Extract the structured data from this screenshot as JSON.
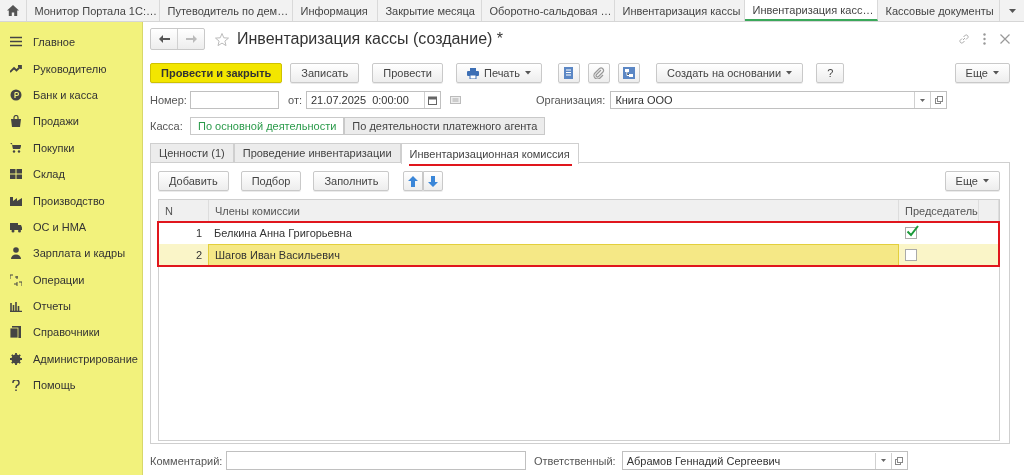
{
  "top_tabs": [
    {
      "label": "Монитор Портала 1С:…",
      "selected": false
    },
    {
      "label": "Путеводитель по дем…",
      "selected": false
    },
    {
      "label": "Информация",
      "selected": false
    },
    {
      "label": "Закрытие месяца",
      "selected": false
    },
    {
      "label": "Оборотно-сальдовая …",
      "selected": false
    },
    {
      "label": "Инвентаризация кассы",
      "selected": false
    },
    {
      "label": "Инвентаризация касс…",
      "selected": true
    },
    {
      "label": "Кассовые документы",
      "selected": false
    }
  ],
  "sidebar": {
    "items": [
      {
        "label": "Главное"
      },
      {
        "label": "Руководителю"
      },
      {
        "label": "Банк и касса"
      },
      {
        "label": "Продажи"
      },
      {
        "label": "Покупки"
      },
      {
        "label": "Склад"
      },
      {
        "label": "Производство"
      },
      {
        "label": "ОС и НМА"
      },
      {
        "label": "Зарплата и кадры"
      },
      {
        "label": "Операции"
      },
      {
        "label": "Отчеты"
      },
      {
        "label": "Справочники"
      },
      {
        "label": "Администрирование"
      },
      {
        "label": "Помощь"
      }
    ]
  },
  "form": {
    "title": "Инвентаризация кассы (создание) *",
    "toolbar": [
      {
        "kind": "primary",
        "label": "Провести и закрыть"
      },
      {
        "kind": "plain",
        "label": "Записать"
      },
      {
        "kind": "plain",
        "label": "Провести"
      },
      {
        "kind": "print",
        "label": "Печать"
      },
      {
        "kind": "icon"
      },
      {
        "kind": "icon"
      },
      {
        "kind": "icon"
      },
      {
        "kind": "menu",
        "label": "Создать на основании"
      },
      {
        "kind": "plain",
        "label": "?"
      },
      {
        "kind": "more",
        "label": "Еще"
      }
    ],
    "number": {
      "label": "Номер:"
    },
    "date": {
      "label": "от:",
      "value": "21.07.2025  0:00:00"
    },
    "organization": {
      "label": "Организация:",
      "value": "Книга ООО"
    },
    "kassa": {
      "label": "Касса:",
      "options": [
        {
          "label": "По основной деятельности",
          "selected": true
        },
        {
          "label": "По деятельности платежного агента",
          "selected": false
        }
      ]
    },
    "tabs": [
      {
        "label": "Ценности (1)",
        "selected": false,
        "marked": false
      },
      {
        "label": "Проведение инвентаризации",
        "selected": false,
        "marked": false
      },
      {
        "label": "Инвентаризационная комиссия",
        "selected": true,
        "marked": true
      }
    ],
    "table_toolbar": [
      {
        "kind": "plain",
        "label": "Добавить"
      },
      {
        "kind": "plain",
        "label": "Подбор"
      },
      {
        "kind": "plain",
        "label": "Заполнить"
      },
      {
        "kind": "up"
      },
      {
        "kind": "down"
      },
      {
        "kind": "more",
        "label": "Еще"
      }
    ],
    "table": {
      "highlighted": true,
      "columns": [
        "N",
        "Члены комиссии",
        "Председатель"
      ],
      "rows": [
        {
          "n": "1",
          "member": "Белкина Анна Григорьевна",
          "checked": true,
          "selected": false
        },
        {
          "n": "2",
          "member": "Шагов Иван Васильевич",
          "checked": false,
          "selected": true
        }
      ]
    },
    "comment": {
      "label": "Комментарий:"
    },
    "responsible": {
      "label": "Ответственный:",
      "value": "Абрамов Геннадий Сергеевич"
    }
  }
}
